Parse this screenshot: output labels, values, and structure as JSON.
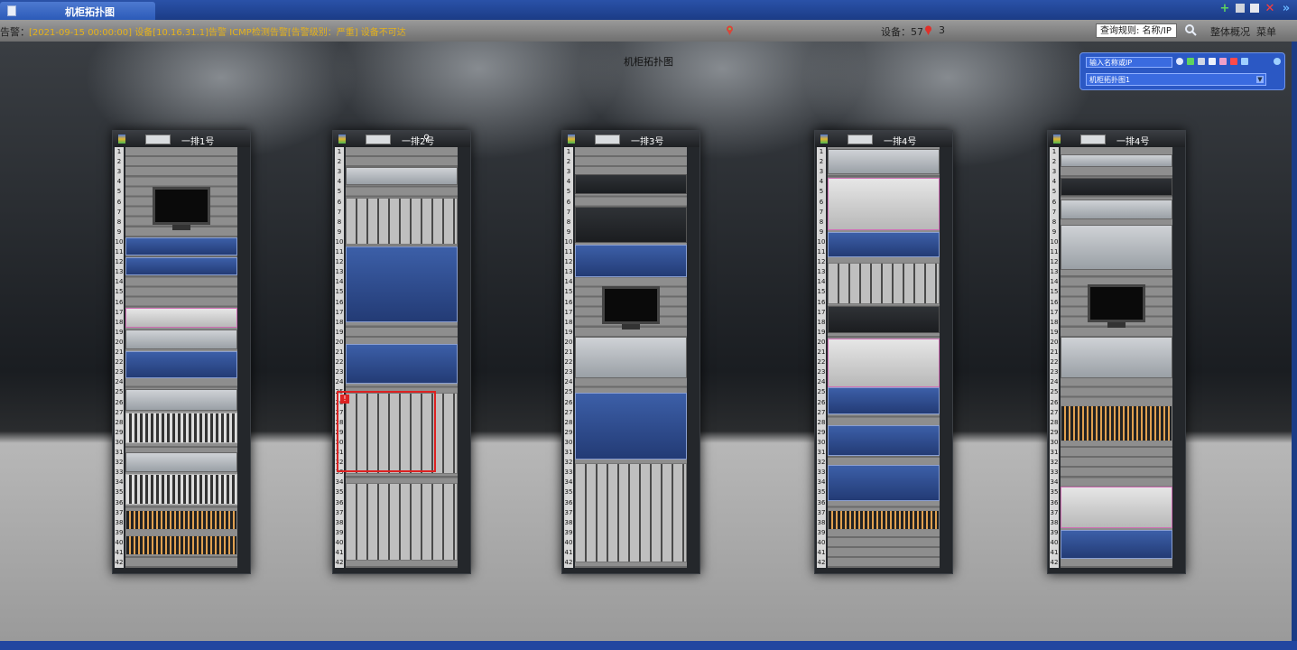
{
  "tab": {
    "title": "机柜拓扑图"
  },
  "alarm": {
    "label": "告警：",
    "text": "[2021-09-15 00:00:00] 设备[10.16.31.1]告警 ICMP检测告警[告警级别：严重] 设备不可达"
  },
  "devices": {
    "label": "设备：57",
    "alarm_count": "3"
  },
  "search": {
    "rule": "查询规则: 名称/IP"
  },
  "buttons": {
    "overview": "整体概况",
    "menu": "菜单"
  },
  "topology": {
    "title": "机柜拓扑图"
  },
  "panel": {
    "input_placeholder": "输入名称或IP",
    "select_value": "机柜拓扑图1"
  },
  "racks": [
    {
      "name": "一排1号"
    },
    {
      "name": "一排2号"
    },
    {
      "name": "一排3号"
    },
    {
      "name": "一排4号"
    },
    {
      "name": "一排4号"
    }
  ],
  "units": [
    "1",
    "2",
    "3",
    "4",
    "5",
    "6",
    "7",
    "8",
    "9",
    "10",
    "11",
    "12",
    "13",
    "14",
    "15",
    "16",
    "17",
    "18",
    "19",
    "20",
    "21",
    "22",
    "23",
    "24",
    "25",
    "26",
    "27",
    "28",
    "29",
    "30",
    "31",
    "32",
    "33",
    "34",
    "35",
    "36",
    "37",
    "38",
    "39",
    "40",
    "41",
    "42"
  ],
  "colors": {
    "titlebar": "#1b3c86",
    "alarm_text": "#e6b21a",
    "alert_border": "#dd2222"
  }
}
